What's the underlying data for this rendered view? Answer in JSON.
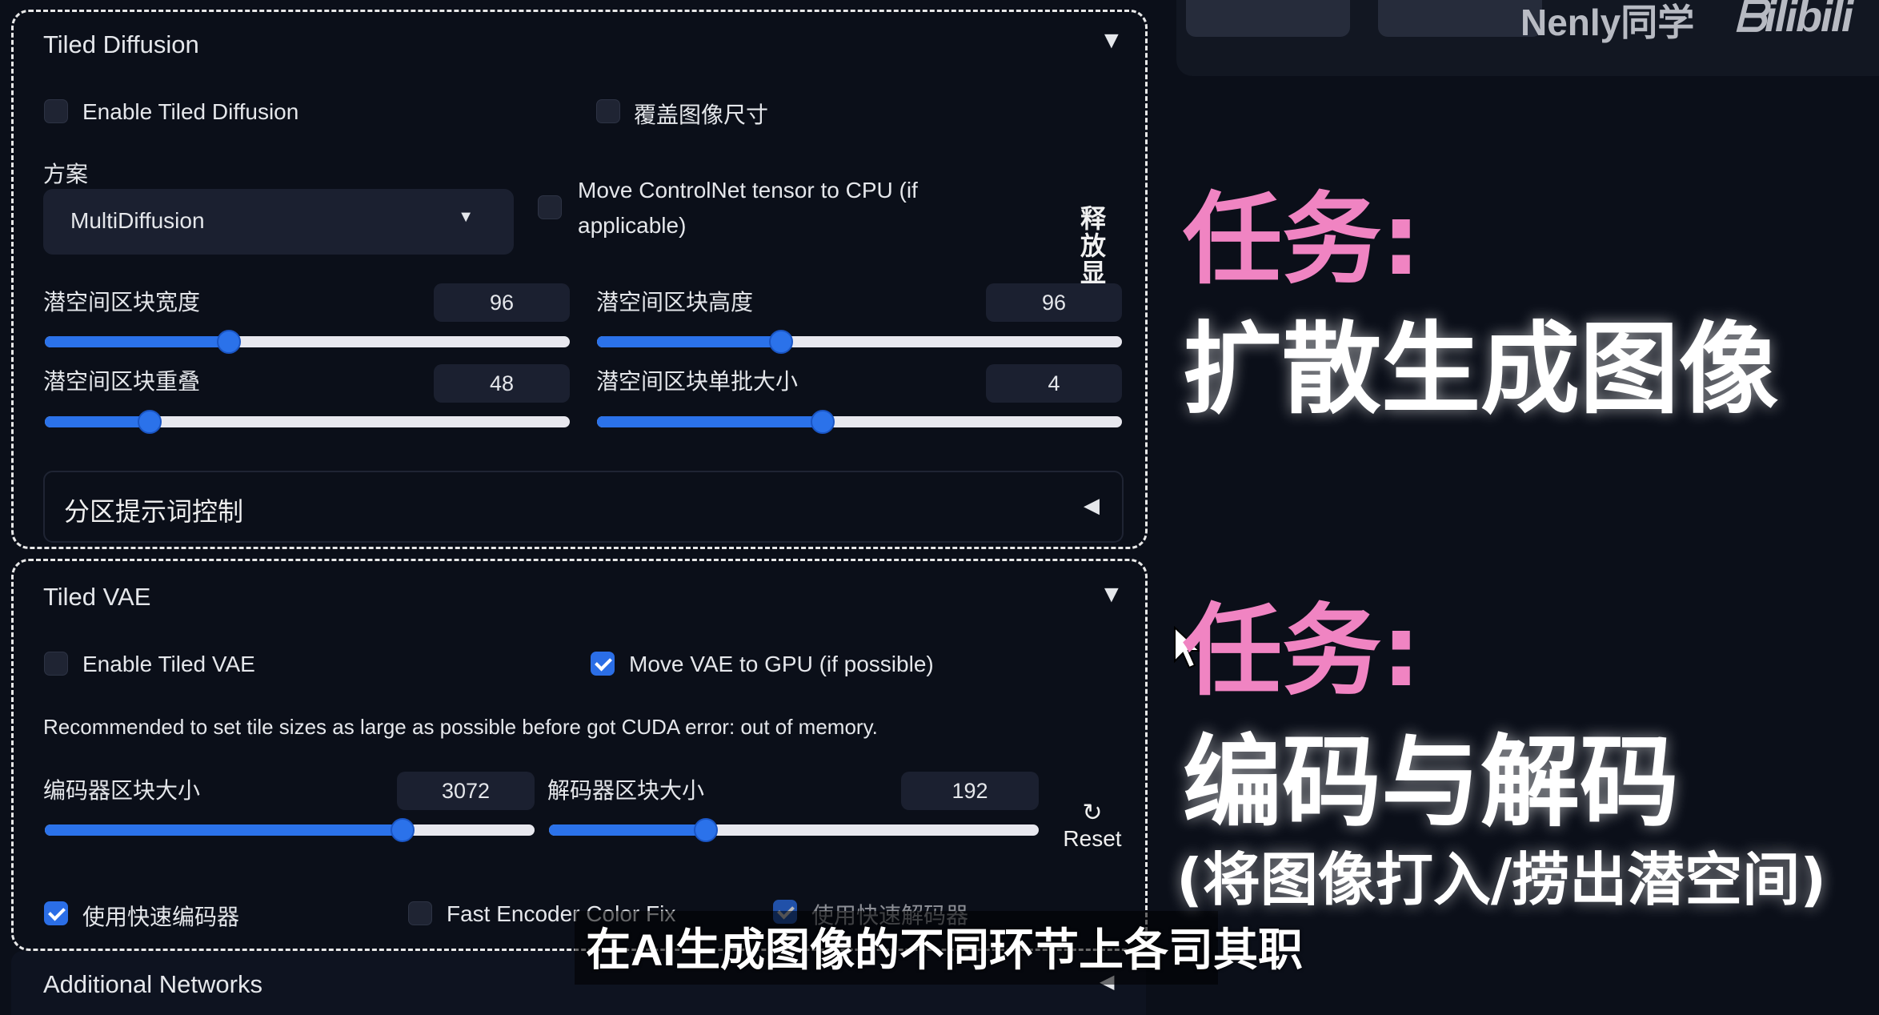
{
  "watermark": {
    "author": "Nenly同学",
    "logo": "bilibili"
  },
  "tiled_diffusion": {
    "title": "Tiled Diffusion",
    "enable_label": "Enable Tiled Diffusion",
    "enable_checked": false,
    "override_size_label": "覆盖图像尺寸",
    "override_size_checked": false,
    "method_label": "方案",
    "method_value": "MultiDiffusion",
    "controlnet_cpu_label_line1": "Move ControlNet tensor to CPU (if",
    "controlnet_cpu_label_line2": "applicable)",
    "controlnet_cpu_checked": false,
    "free_vram_label": "释放显",
    "latent_tile_width": {
      "label": "潜空间区块宽度",
      "value": "96",
      "fraction": 0.35
    },
    "latent_tile_height": {
      "label": "潜空间区块高度",
      "value": "96",
      "fraction": 0.35
    },
    "latent_tile_overlap": {
      "label": "潜空间区块重叠",
      "value": "48",
      "fraction": 0.2
    },
    "latent_tile_batch": {
      "label": "潜空间区块单批大小",
      "value": "4",
      "fraction": 0.43
    },
    "region_prompt_label": "分区提示词控制"
  },
  "tiled_vae": {
    "title": "Tiled VAE",
    "enable_label": "Enable Tiled VAE",
    "enable_checked": false,
    "move_vae_label": "Move VAE to GPU (if possible)",
    "move_vae_checked": true,
    "recommend_text": "Recommended to set tile sizes as large as possible before got CUDA error: out of memory.",
    "encoder_tile": {
      "label": "编码器区块大小",
      "value": "3072",
      "fraction": 0.73
    },
    "decoder_tile": {
      "label": "解码器区块大小",
      "value": "192",
      "fraction": 0.32
    },
    "reset_icon": "↻",
    "reset_label": "Reset",
    "fast_encoder_label": "使用快速编码器",
    "fast_encoder_checked": true,
    "fast_encoder_color_fix_label": "Fast Encoder Color Fix",
    "fast_encoder_color_fix_checked": false,
    "fast_decoder_label": "使用快速解码器",
    "fast_decoder_checked": true
  },
  "additional_networks": {
    "title": "Additional Networks"
  },
  "annotations": {
    "task1_label": "任务:",
    "task1_text": "扩散生成图像",
    "task2_label": "任务:",
    "task2_text": "编码与解码",
    "task2_sub": "(将图像打入/捞出潜空间)"
  },
  "subtitle": "在AI生成图像的不同环节上各司其职",
  "colors": {
    "accent": "#2b72ea",
    "pink": "#f084c2",
    "background": "#0b0f19"
  }
}
